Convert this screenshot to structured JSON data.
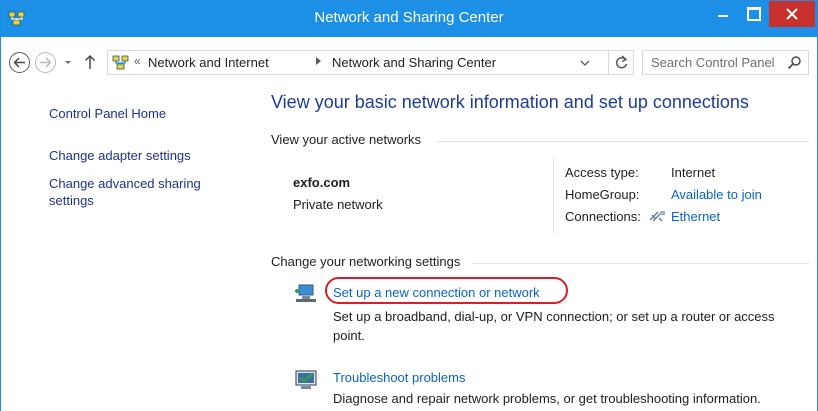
{
  "window": {
    "title": "Network and Sharing Center"
  },
  "addressbar": {
    "overflow_chevron": "«",
    "crumbs": [
      "Network and Internet",
      "Network and Sharing Center"
    ]
  },
  "search": {
    "placeholder": "Search Control Panel"
  },
  "sidebar": {
    "items": [
      {
        "label": "Control Panel Home"
      },
      {
        "label": "Change adapter settings"
      },
      {
        "label": "Change advanced sharing settings"
      }
    ]
  },
  "main": {
    "heading": "View your basic network information and set up connections",
    "active_networks_label": "View your active networks",
    "network": {
      "name": "exfo.com",
      "type": "Private network",
      "access_type_label": "Access type:",
      "access_type_value": "Internet",
      "homegroup_label": "HomeGroup:",
      "homegroup_value": "Available to join",
      "connections_label": "Connections:",
      "connections_value": "Ethernet"
    },
    "settings_label": "Change your networking settings",
    "tasks": [
      {
        "title": "Set up a new connection or network",
        "description": "Set up a broadband, dial-up, or VPN connection; or set up a router or access point."
      },
      {
        "title": "Troubleshoot problems",
        "description": "Diagnose and repair network problems, or get troubleshooting information."
      }
    ]
  },
  "colors": {
    "titlebar": "#1c8fe6",
    "close_button": "#c7302d",
    "link": "#0a64c8",
    "heading": "#1e3c96",
    "highlight": "#d4202a"
  }
}
